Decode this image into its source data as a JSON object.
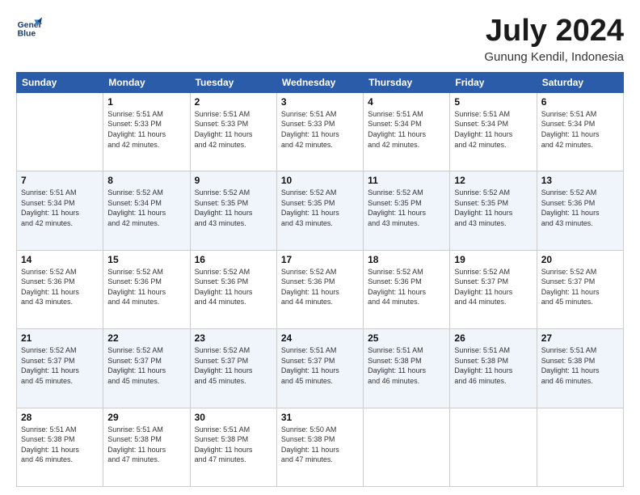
{
  "header": {
    "logo_line1": "General",
    "logo_line2": "Blue",
    "title": "July 2024",
    "subtitle": "Gunung Kendil, Indonesia"
  },
  "columns": [
    "Sunday",
    "Monday",
    "Tuesday",
    "Wednesday",
    "Thursday",
    "Friday",
    "Saturday"
  ],
  "weeks": [
    [
      {
        "day": "",
        "info": ""
      },
      {
        "day": "1",
        "info": "Sunrise: 5:51 AM\nSunset: 5:33 PM\nDaylight: 11 hours\nand 42 minutes."
      },
      {
        "day": "2",
        "info": "Sunrise: 5:51 AM\nSunset: 5:33 PM\nDaylight: 11 hours\nand 42 minutes."
      },
      {
        "day": "3",
        "info": "Sunrise: 5:51 AM\nSunset: 5:33 PM\nDaylight: 11 hours\nand 42 minutes."
      },
      {
        "day": "4",
        "info": "Sunrise: 5:51 AM\nSunset: 5:34 PM\nDaylight: 11 hours\nand 42 minutes."
      },
      {
        "day": "5",
        "info": "Sunrise: 5:51 AM\nSunset: 5:34 PM\nDaylight: 11 hours\nand 42 minutes."
      },
      {
        "day": "6",
        "info": "Sunrise: 5:51 AM\nSunset: 5:34 PM\nDaylight: 11 hours\nand 42 minutes."
      }
    ],
    [
      {
        "day": "7",
        "info": "Sunrise: 5:51 AM\nSunset: 5:34 PM\nDaylight: 11 hours\nand 42 minutes."
      },
      {
        "day": "8",
        "info": "Sunrise: 5:52 AM\nSunset: 5:34 PM\nDaylight: 11 hours\nand 42 minutes."
      },
      {
        "day": "9",
        "info": "Sunrise: 5:52 AM\nSunset: 5:35 PM\nDaylight: 11 hours\nand 43 minutes."
      },
      {
        "day": "10",
        "info": "Sunrise: 5:52 AM\nSunset: 5:35 PM\nDaylight: 11 hours\nand 43 minutes."
      },
      {
        "day": "11",
        "info": "Sunrise: 5:52 AM\nSunset: 5:35 PM\nDaylight: 11 hours\nand 43 minutes."
      },
      {
        "day": "12",
        "info": "Sunrise: 5:52 AM\nSunset: 5:35 PM\nDaylight: 11 hours\nand 43 minutes."
      },
      {
        "day": "13",
        "info": "Sunrise: 5:52 AM\nSunset: 5:36 PM\nDaylight: 11 hours\nand 43 minutes."
      }
    ],
    [
      {
        "day": "14",
        "info": "Sunrise: 5:52 AM\nSunset: 5:36 PM\nDaylight: 11 hours\nand 43 minutes."
      },
      {
        "day": "15",
        "info": "Sunrise: 5:52 AM\nSunset: 5:36 PM\nDaylight: 11 hours\nand 44 minutes."
      },
      {
        "day": "16",
        "info": "Sunrise: 5:52 AM\nSunset: 5:36 PM\nDaylight: 11 hours\nand 44 minutes."
      },
      {
        "day": "17",
        "info": "Sunrise: 5:52 AM\nSunset: 5:36 PM\nDaylight: 11 hours\nand 44 minutes."
      },
      {
        "day": "18",
        "info": "Sunrise: 5:52 AM\nSunset: 5:36 PM\nDaylight: 11 hours\nand 44 minutes."
      },
      {
        "day": "19",
        "info": "Sunrise: 5:52 AM\nSunset: 5:37 PM\nDaylight: 11 hours\nand 44 minutes."
      },
      {
        "day": "20",
        "info": "Sunrise: 5:52 AM\nSunset: 5:37 PM\nDaylight: 11 hours\nand 45 minutes."
      }
    ],
    [
      {
        "day": "21",
        "info": "Sunrise: 5:52 AM\nSunset: 5:37 PM\nDaylight: 11 hours\nand 45 minutes."
      },
      {
        "day": "22",
        "info": "Sunrise: 5:52 AM\nSunset: 5:37 PM\nDaylight: 11 hours\nand 45 minutes."
      },
      {
        "day": "23",
        "info": "Sunrise: 5:52 AM\nSunset: 5:37 PM\nDaylight: 11 hours\nand 45 minutes."
      },
      {
        "day": "24",
        "info": "Sunrise: 5:51 AM\nSunset: 5:37 PM\nDaylight: 11 hours\nand 45 minutes."
      },
      {
        "day": "25",
        "info": "Sunrise: 5:51 AM\nSunset: 5:38 PM\nDaylight: 11 hours\nand 46 minutes."
      },
      {
        "day": "26",
        "info": "Sunrise: 5:51 AM\nSunset: 5:38 PM\nDaylight: 11 hours\nand 46 minutes."
      },
      {
        "day": "27",
        "info": "Sunrise: 5:51 AM\nSunset: 5:38 PM\nDaylight: 11 hours\nand 46 minutes."
      }
    ],
    [
      {
        "day": "28",
        "info": "Sunrise: 5:51 AM\nSunset: 5:38 PM\nDaylight: 11 hours\nand 46 minutes."
      },
      {
        "day": "29",
        "info": "Sunrise: 5:51 AM\nSunset: 5:38 PM\nDaylight: 11 hours\nand 47 minutes."
      },
      {
        "day": "30",
        "info": "Sunrise: 5:51 AM\nSunset: 5:38 PM\nDaylight: 11 hours\nand 47 minutes."
      },
      {
        "day": "31",
        "info": "Sunrise: 5:50 AM\nSunset: 5:38 PM\nDaylight: 11 hours\nand 47 minutes."
      },
      {
        "day": "",
        "info": ""
      },
      {
        "day": "",
        "info": ""
      },
      {
        "day": "",
        "info": ""
      }
    ]
  ]
}
